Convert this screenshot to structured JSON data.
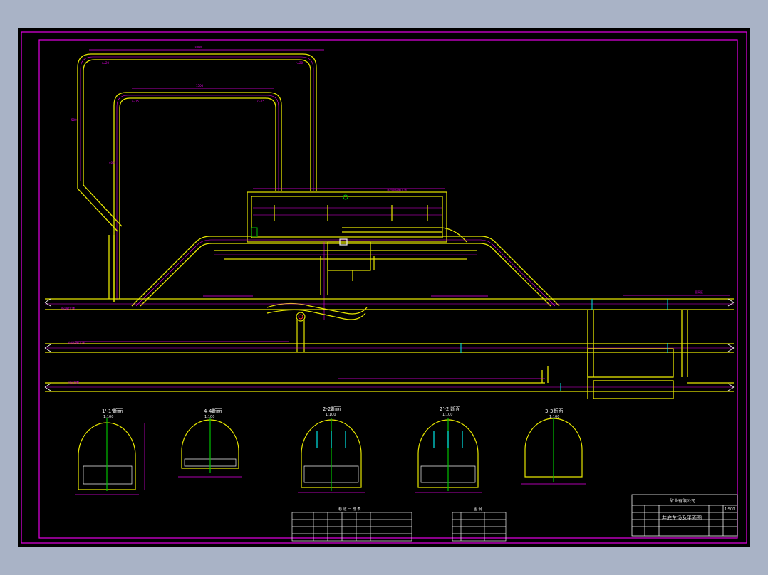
{
  "sections": [
    {
      "title": "1'-1'断面",
      "scale": "1:100"
    },
    {
      "title": "4-4断面",
      "scale": "1:100"
    },
    {
      "title": "2-2断面",
      "scale": "1:100"
    },
    {
      "title": "2'-2'断面",
      "scale": "1:100"
    },
    {
      "title": "3-3断面",
      "scale": "1:100"
    }
  ],
  "table1": {
    "title": "巷 道 一 览 表"
  },
  "legend": {
    "title": "图 例"
  },
  "title_block": {
    "company": "矿业有限公司",
    "drawing_title": "井底车场及平面图",
    "scale_value": "1:500"
  },
  "colors": {
    "background": "#000000",
    "frame": "#e600e6",
    "tunnel_wall": "#e6e600",
    "dimension": "#e600e6",
    "centerline": "#00c000",
    "annotation": "#ff3030",
    "outer_area": "#a9b3c6"
  }
}
